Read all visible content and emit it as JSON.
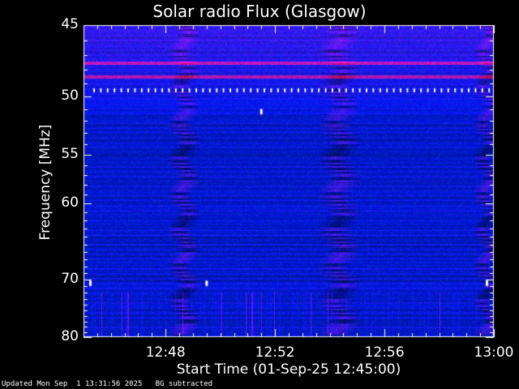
{
  "chart_data": {
    "type": "heatmap",
    "title": "Solar radio Flux (Glasgow)",
    "xlabel": "Start Time (01-Sep-25 12:45:00)",
    "ylabel": "Frequency [MHz]",
    "x_range": [
      "12:45:00",
      "13:00:00"
    ],
    "y_range": [
      45,
      80
    ],
    "y_scale": "reciprocal",
    "y_ticks": [
      45,
      50,
      55,
      60,
      70,
      80
    ],
    "y_tick_labels": [
      "45",
      "50",
      "55",
      "60",
      "70",
      "80"
    ],
    "x_ticks": [
      "12:48",
      "12:52",
      "12:56",
      "13:00"
    ],
    "x_tick_labels": [
      "12:48",
      "12:52",
      "12:56",
      "13:00"
    ],
    "colormap": [
      "#000080",
      "#1020ff",
      "#6010c0",
      "#c00020"
    ],
    "features": [
      {
        "name": "horizontal bright band",
        "frequency_mhz": 47.5,
        "level": "high"
      },
      {
        "name": "horizontal bright band",
        "frequency_mhz": 48.5,
        "level": "high"
      },
      {
        "name": "periodic pulses",
        "frequency_mhz": 49.5,
        "level": "max"
      },
      {
        "name": "wavy interference",
        "time_start": "12:48:20",
        "time_end": "12:49:00"
      },
      {
        "name": "wavy interference",
        "time_start": "12:53:50",
        "time_end": "12:54:50"
      },
      {
        "name": "wavy interference",
        "time_start": "12:59:30",
        "time_end": "13:00:00"
      },
      {
        "name": "point source",
        "time": "12:45:15",
        "frequency_mhz": 70.5
      },
      {
        "name": "point source",
        "time": "12:49:30",
        "frequency_mhz": 70.5
      },
      {
        "name": "point source",
        "time": "12:51:30",
        "frequency_mhz": 51.2
      },
      {
        "name": "point source",
        "time": "12:59:45",
        "frequency_mhz": 70.5
      }
    ]
  },
  "footer": {
    "updated": "Updated Mon Sep  1 13:31:56 2025",
    "note": "BG subtracted"
  }
}
